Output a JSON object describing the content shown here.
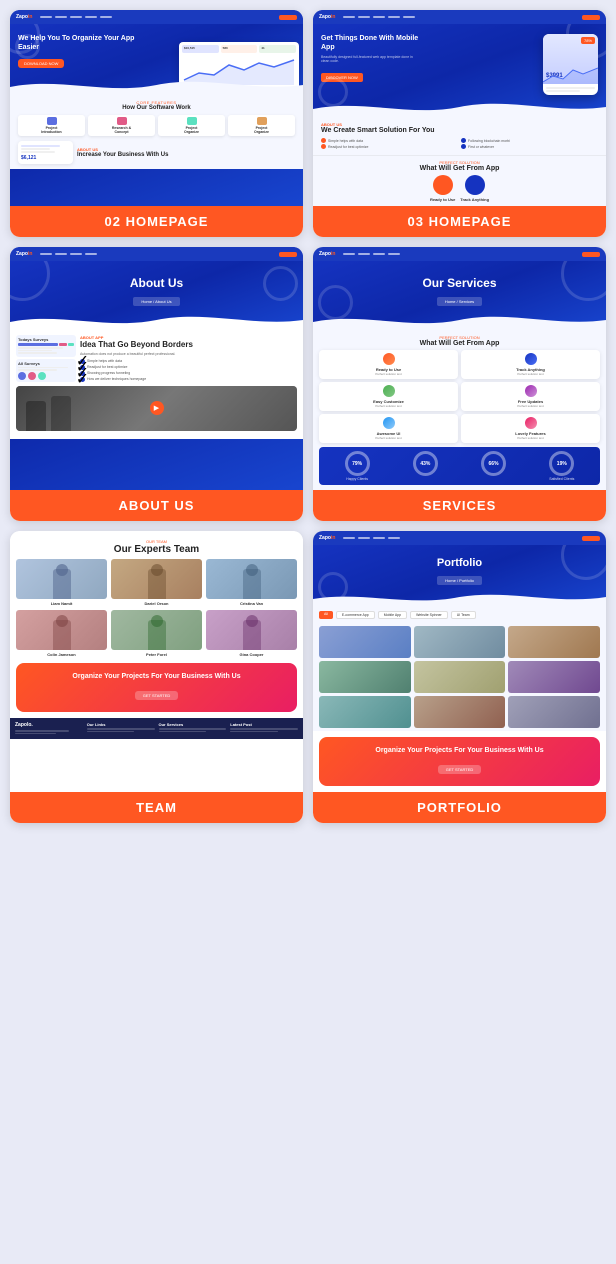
{
  "cards": [
    {
      "id": "card-02-homepage",
      "label": "02 HOMEPAGE",
      "hero_headline": "We Help You To Organize Your App Easier",
      "hero_cta": "DOWNLOAD NOW",
      "features_subtitle": "CORE FEATURES",
      "features_title": "How Our Software Work",
      "features": [
        {
          "name": "Project Introduction",
          "color": "#5b6ee1"
        },
        {
          "name": "Research & Concept",
          "color": "#e15b87"
        },
        {
          "name": "Project Organize",
          "color": "#5be1c0"
        },
        {
          "name": "Project Organize",
          "color": "#e1a05b"
        }
      ],
      "about_subtitle": "ABOUT US",
      "about_title": "Increase Your Business With Us",
      "about_price": "$6,121"
    },
    {
      "id": "card-03-homepage",
      "label": "03 HOMEPAGE",
      "hero_headline": "Get Things Done With Mobile App",
      "hero_cta": "DISCOVER NOW",
      "about_subtitle": "ABOUT US",
      "about_title": "We Create Smart Solution For You",
      "perfect_subtitle": "PERFECT SOLUTION",
      "perfect_title": "What Will Get From App",
      "features": [
        "Ready to Use",
        "Track Anything"
      ]
    },
    {
      "id": "card-about-us",
      "label": "ABOUT US",
      "hero_title": "About Us",
      "breadcrumb": "Home / About Us",
      "about_app_subtitle": "ABOUT APP",
      "about_app_title": "Idea That Go Beyond Borders",
      "checks": [
        "Simple helps with data",
        "Readjust for best optimize",
        "Showing progress funneling",
        "How we deliver techniques homepage"
      ]
    },
    {
      "id": "card-services",
      "label": "SERVICES",
      "hero_title": "Our Services",
      "breadcrumb": "Home / Services",
      "perfect_subtitle": "PERFECT SOLUTION",
      "perfect_title": "What Will Get From App",
      "services": [
        {
          "name": "Ready to Use",
          "color": "#ff5722"
        },
        {
          "name": "Track Anything",
          "color": "#1533c0"
        },
        {
          "name": "Easy Customize",
          "color": "#4caf50"
        },
        {
          "name": "Free Updates",
          "color": "#9c27b0"
        },
        {
          "name": "Awesome UI",
          "color": "#2196f3"
        },
        {
          "name": "Lovely Features",
          "color": "#e91e63"
        }
      ],
      "stats": [
        {
          "value": "79%",
          "label": "Happy Clients"
        },
        {
          "value": "43%",
          "label": ""
        },
        {
          "value": "66%",
          "label": ""
        },
        {
          "value": "19%",
          "label": "Satisfied Clients"
        }
      ]
    },
    {
      "id": "card-team",
      "label": "TEAM",
      "team_subtitle": "OUR TEAM",
      "team_title": "Our Experts Team",
      "members": [
        {
          "name": "Liam Namit",
          "color": "#b0c4de"
        },
        {
          "name": "Dariel Orson",
          "color": "#c4a882"
        },
        {
          "name": "Cristina Van",
          "color": "#9ab8d4"
        },
        {
          "name": "Colin Jameson",
          "color": "#d4a0a0"
        },
        {
          "name": "Peter Forel",
          "color": "#a0b8a0"
        },
        {
          "name": "Gina Cooper",
          "color": "#c8a0c8"
        }
      ],
      "cta_title": "Organize Your Projects For Your Business With Us",
      "cta_btn": "GET STARTED",
      "footer_cols": [
        "Our Links",
        "Our Services",
        "Latest Post"
      ]
    },
    {
      "id": "card-portfolio",
      "label": "PORTFOLIO",
      "hero_title": "Portfolio",
      "breadcrumb": "Home / Portfolio",
      "filters": [
        "E-commerce App",
        "Mobile App",
        "Website Spinner",
        "UI Team"
      ],
      "portfolio_items": [
        {
          "color": "#8a9fd4"
        },
        {
          "color": "#a0b8c4"
        },
        {
          "color": "#c4a88a"
        },
        {
          "color": "#8ab8a0"
        },
        {
          "color": "#c4c4a0"
        },
        {
          "color": "#a08ab8"
        },
        {
          "color": "#8ab8b8"
        },
        {
          "color": "#b8a08a"
        },
        {
          "color": "#a0a0b8"
        }
      ],
      "cta_title": "Organize Your Projects For Your Business With Us",
      "cta_btn": "GET STARTED"
    }
  ]
}
